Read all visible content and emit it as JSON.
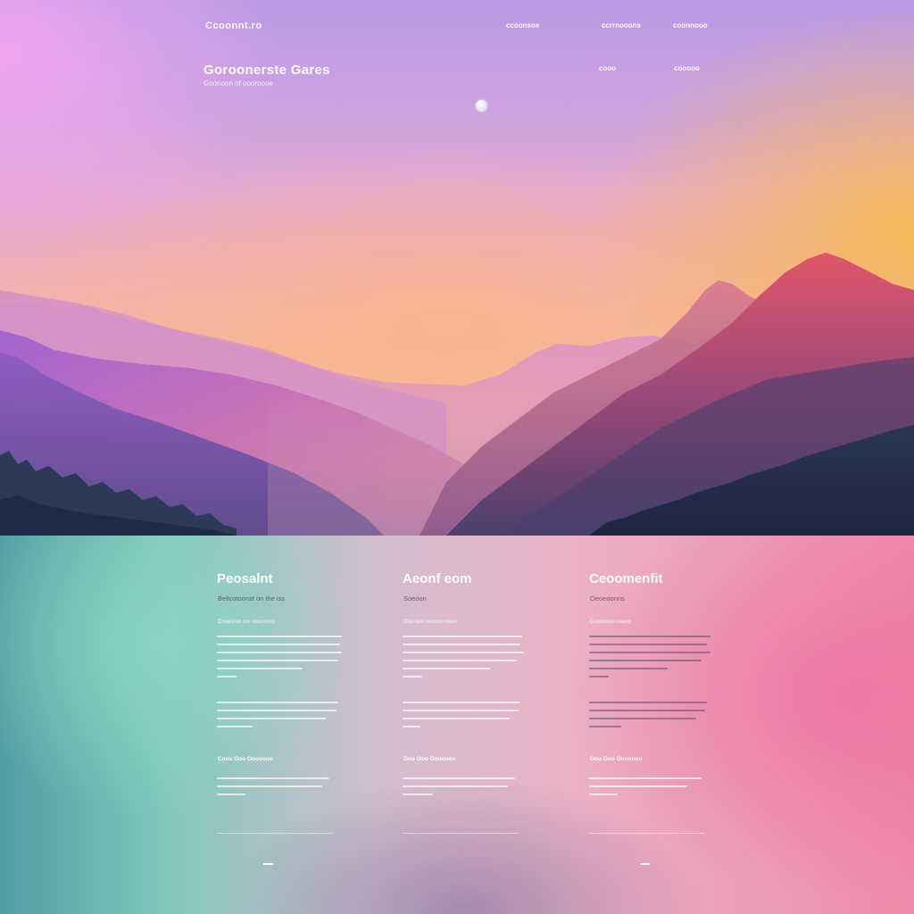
{
  "colors": {
    "hero_sky_top": "#b99be4",
    "hero_sky_glow": "#f7ba50",
    "mountain_far": "#d690c6",
    "mountain_mid": "#a068b8",
    "mountain_near_right": "#c8486a",
    "forest": "#22304a",
    "features_left": "#4f9ea2",
    "features_right": "#ee8aa9"
  },
  "header": {
    "logo": "Ccoonnt.ro"
  },
  "nav": {
    "items": [
      {
        "label": "ccoonsoe"
      },
      {
        "label": "ccrrnooons"
      },
      {
        "label": "coonnooo"
      }
    ]
  },
  "sub_nav": {
    "items": [
      {
        "label": "cooo"
      },
      {
        "label": "cooooo"
      }
    ]
  },
  "hero": {
    "title": "Goroonerste Gares",
    "subtitle": "Goonoon of oooroooe"
  },
  "features": [
    {
      "title": "Peosalnt",
      "tagline": "Bellcotoonst on the iss",
      "kicker": "Cooeoroo oor ooooooro",
      "link": "Coos Ooo Ooooooo"
    },
    {
      "title": "Aeonf eom",
      "tagline": "Soeoon",
      "kicker": "Ooo ooo oooooo oooo",
      "link": "Ooo Ooo Ooooooo"
    },
    {
      "title": "Ceoomenfit",
      "tagline": "Oeoeoonns",
      "kicker": "Cooooooo ooooo",
      "link": "Ooo Ooo Ooooooo"
    }
  ]
}
